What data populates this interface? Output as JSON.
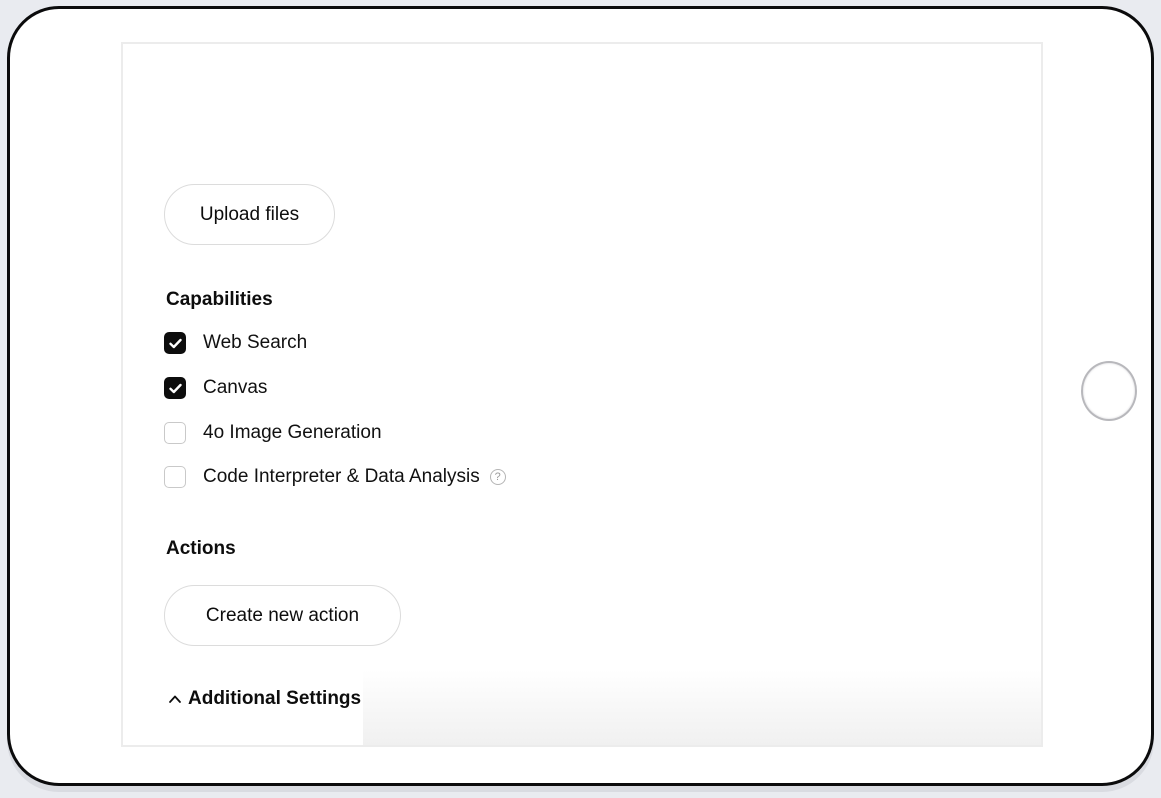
{
  "main": {
    "upload_files_label": "Upload files",
    "capabilities_title": "Capabilities",
    "capabilities": [
      {
        "label": "Web Search",
        "checked": true
      },
      {
        "label": "Canvas",
        "checked": true
      },
      {
        "label": "4o Image Generation",
        "checked": false
      },
      {
        "label": "Code Interpreter & Data Analysis",
        "checked": false,
        "help_icon": "?"
      }
    ],
    "actions_title": "Actions",
    "create_action_label": "Create new action",
    "additional_settings_label": "Additional Settings"
  },
  "icons": {
    "checkbox_checked": "checkmark-icon",
    "help": "question-circle-icon",
    "additional_settings": "chevron-up-icon"
  },
  "colors": {
    "checked_fill": "#0d0d0d",
    "text": "#0d0d0d",
    "device_frame": "#0b0b0c"
  }
}
